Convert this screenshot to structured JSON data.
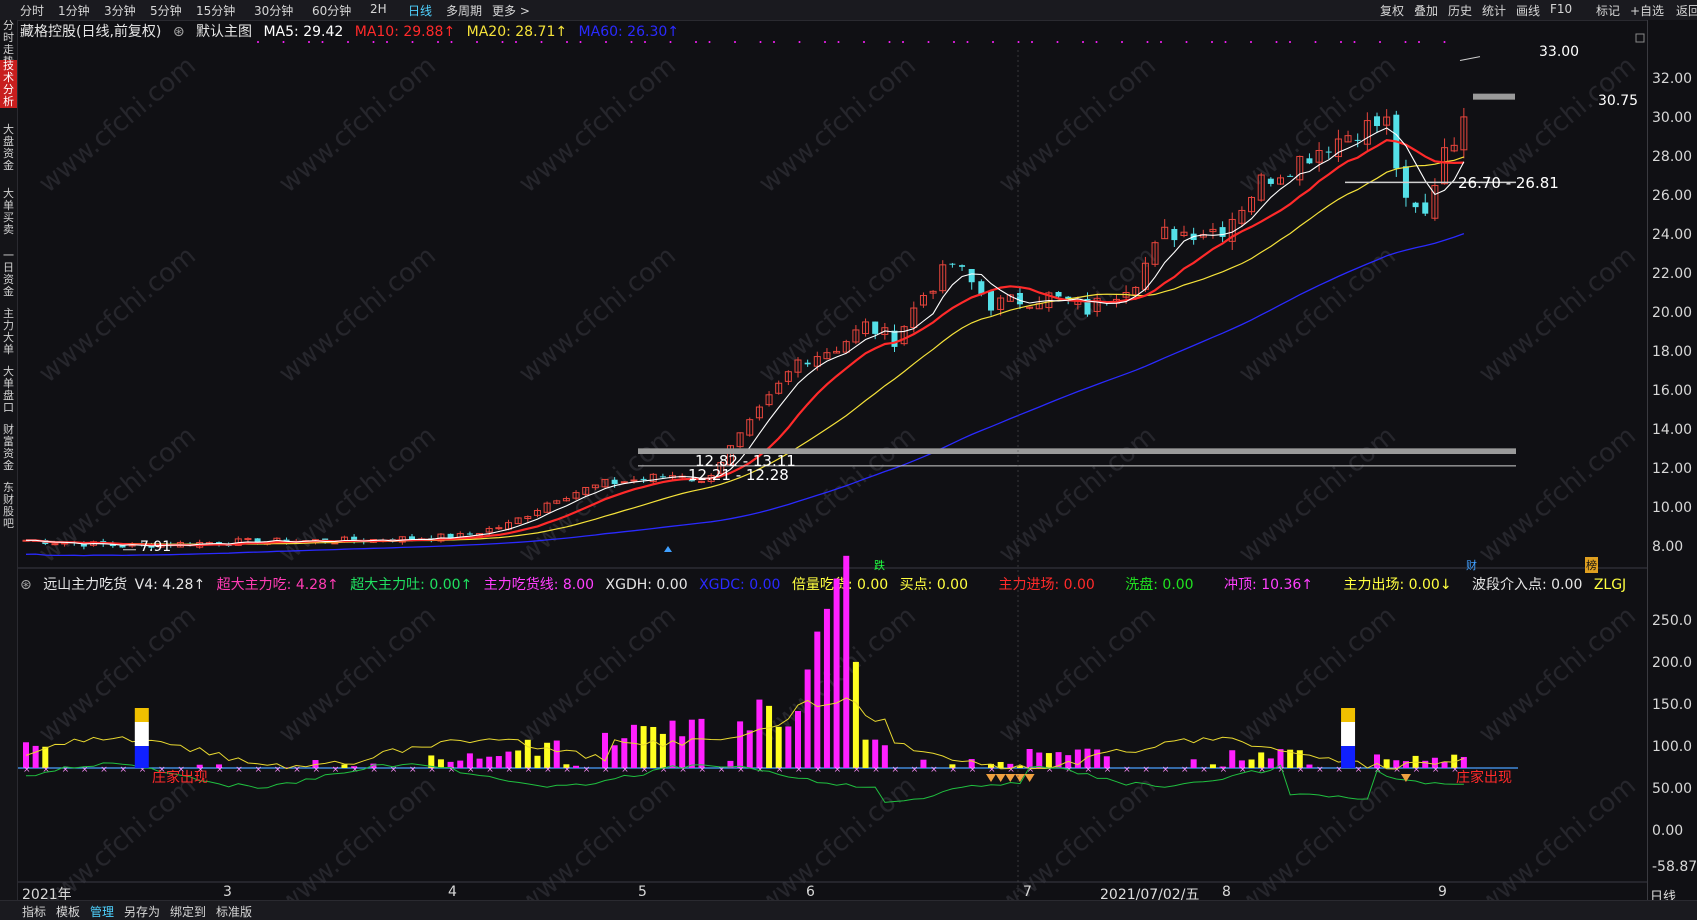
{
  "topbar": {
    "left_items": [
      "分时",
      "1分钟",
      "3分钟",
      "5分钟",
      "15分钟",
      "30分钟",
      "60分钟",
      "2H",
      "日线",
      "多周期",
      "更多 >"
    ],
    "active_item": "日线",
    "right_items": [
      "复权",
      "叠加",
      "历史",
      "统计",
      "画线",
      "F10",
      "标记",
      "+自选",
      "返回"
    ]
  },
  "leftnav": {
    "tabs": [
      "分时走势",
      "技术分析",
      "大盘资金",
      "大单买卖",
      "一日资金",
      "主力大单",
      "大单盘口",
      "财富资金",
      "东财股吧"
    ],
    "active": "技术分析"
  },
  "main_legend": {
    "title": "藏格控股(日线,前复权)",
    "template": "默认主图",
    "ma5": "MA5: 29.42",
    "ma10": "MA10: 29.88↑",
    "ma20": "MA20: 28.71↑",
    "ma60": "MA60: 26.30↑"
  },
  "sub_legend": {
    "name": "远山主力吃货",
    "v4": "V4: 4.28↑",
    "chao_chi": "超大主力吃: 4.28↑",
    "chao_tu": "超大主力吐: 0.00↑",
    "chihuo": "主力吃货线: 8.00",
    "xgdh": "XGDH: 0.00",
    "xgdc": "XGDC: 0.00",
    "beiliang": "倍量吃货: 0.00",
    "maidian": "买点: 0.00",
    "jinchang": "主力进场: 0.00",
    "xipan": "洗盘: 0.00",
    "chongding": "冲顶: 10.36↑",
    "chuchang": "主力出场: 0.00↓",
    "boduan": "波段介入点: 0.00",
    "zlgj": "ZLGJ"
  },
  "price_axis": [
    "32.00",
    "30.00",
    "28.00",
    "26.00",
    "24.00",
    "22.00",
    "20.00",
    "18.00",
    "16.00",
    "14.00",
    "12.00",
    "10.00",
    "8.00"
  ],
  "sub_axis": [
    "250.0",
    "200.0",
    "150.0",
    "100.0",
    "50.00",
    "0.00",
    "-58.87"
  ],
  "annotations": {
    "high": "33.00",
    "last": "30.75",
    "low": "7.91",
    "range1": "26.70 - 26.81",
    "range2": "12.82 - 13.11",
    "range3": "12.21 - 12.28",
    "zhujia1": "庄家出现",
    "zhujia2": "庄家出现",
    "marker_die": "跌",
    "marker_cai": "财",
    "marker_bang": "榜"
  },
  "time_axis": {
    "labels": [
      "2021年",
      "3",
      "4",
      "5",
      "6",
      "7",
      "8",
      "9"
    ],
    "cursor_date": "2021/07/02/五",
    "period": "日线"
  },
  "bottombar": [
    "指标",
    "模板",
    "管理",
    "另存为",
    "绑定到",
    "标准版"
  ],
  "watermark": "www.cfchi.com",
  "colors": {
    "up": "#e8453c",
    "down": "#54e0e8",
    "ma5": "#ffffff",
    "ma10": "#ff2a2a",
    "ma20": "#f5e23a",
    "ma60": "#2a2aff",
    "magenta": "#ff20ff",
    "yellow": "#ffff20",
    "green": "#20c040",
    "accent_red": "#c81e1e"
  }
}
